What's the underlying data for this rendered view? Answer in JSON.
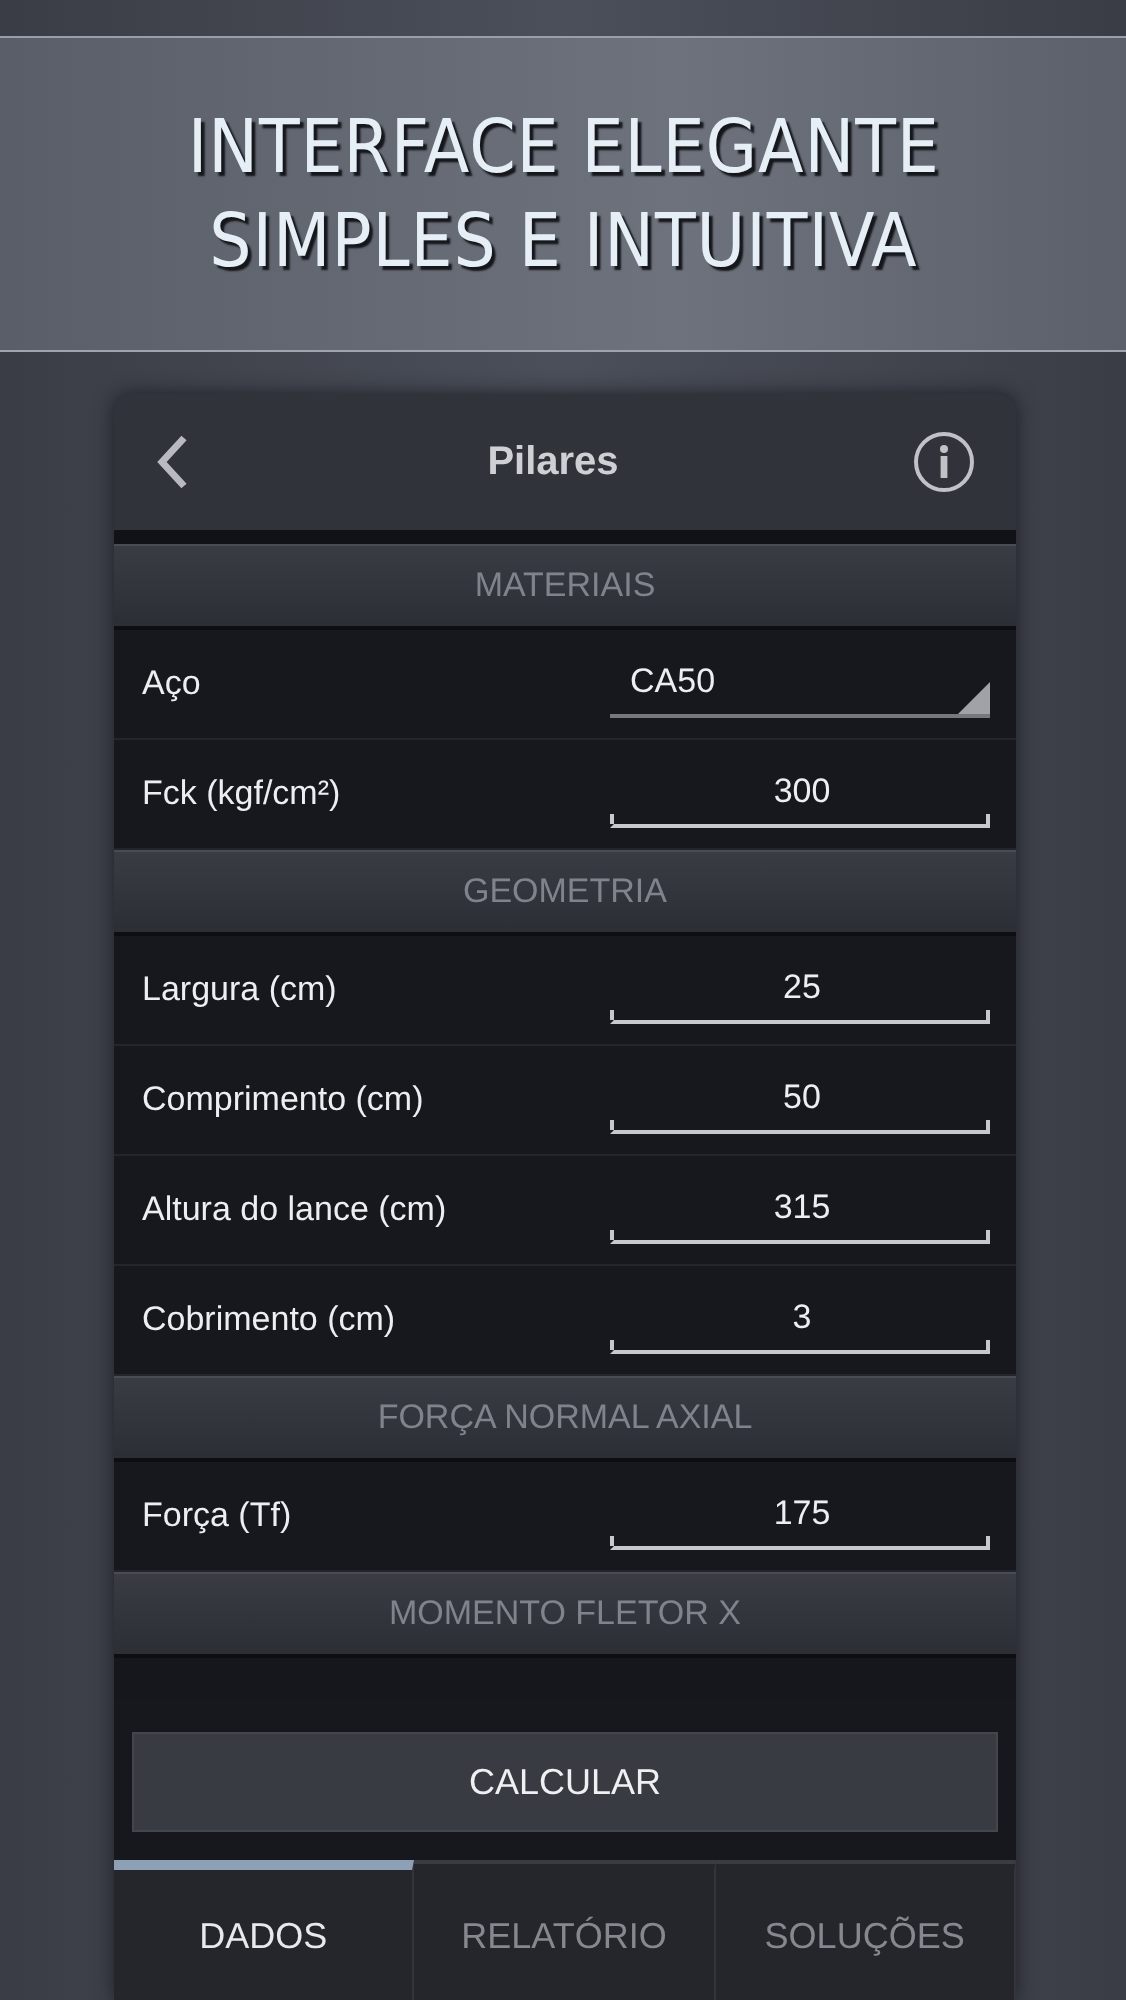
{
  "banner": {
    "lines": [
      "INTERFACE ELEGANTE",
      "SIMPLES E INTUITIVA"
    ]
  },
  "header": {
    "title": "Pilares"
  },
  "sections": [
    {
      "title": "MATERIAIS",
      "rows": [
        {
          "label": "Aço",
          "value": "CA50",
          "kind": "select"
        },
        {
          "label": "Fck (kgf/cm²)",
          "value": "300",
          "kind": "number"
        }
      ]
    },
    {
      "title": "GEOMETRIA",
      "rows": [
        {
          "label": "Largura (cm)",
          "value": "25",
          "kind": "number"
        },
        {
          "label": "Comprimento (cm)",
          "value": "50",
          "kind": "number"
        },
        {
          "label": "Altura do lance (cm)",
          "value": "315",
          "kind": "number"
        },
        {
          "label": "Cobrimento (cm)",
          "value": "3",
          "kind": "number"
        }
      ]
    },
    {
      "title": "FORÇA NORMAL AXIAL",
      "rows": [
        {
          "label": "Força (Tf)",
          "value": "175",
          "kind": "number"
        }
      ]
    },
    {
      "title": "MOMENTO FLETOR X"
    }
  ],
  "calculate_button": "CALCULAR",
  "tabs": [
    {
      "label": "DADOS",
      "selected": true
    },
    {
      "label": "RELATÓRIO",
      "selected": false
    },
    {
      "label": "SOLUÇÕES",
      "selected": false
    }
  ]
}
